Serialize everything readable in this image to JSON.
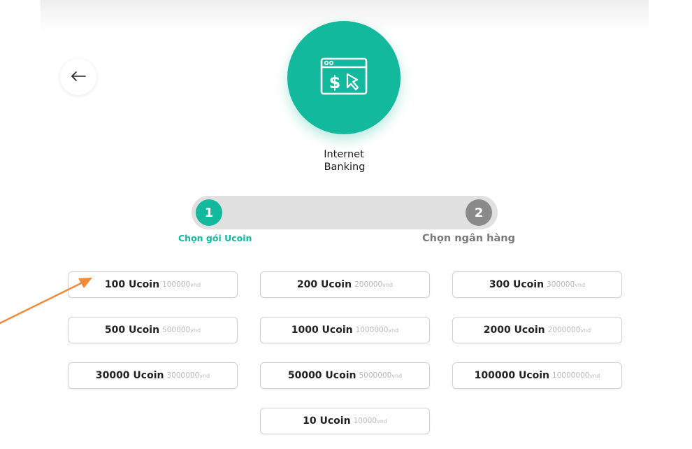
{
  "payment_method": {
    "icon": "online-payment-icon",
    "name_line1": "Internet",
    "name_line2": "Banking"
  },
  "back_icon": "arrow-left-icon",
  "stepper": {
    "steps": [
      {
        "number": "1",
        "label": "Chọn gói Ucoin",
        "active": true
      },
      {
        "number": "2",
        "label": "Chọn ngân hàng",
        "active": false
      }
    ]
  },
  "packages": [
    {
      "ucoin": "100 Ucoin",
      "price": "100000",
      "unit": "vnd"
    },
    {
      "ucoin": "200 Ucoin",
      "price": "200000",
      "unit": "vnd"
    },
    {
      "ucoin": "300 Ucoin",
      "price": "300000",
      "unit": "vnd"
    },
    {
      "ucoin": "500 Ucoin",
      "price": "500000",
      "unit": "vnd"
    },
    {
      "ucoin": "1000 Ucoin",
      "price": "1000000",
      "unit": "vnd"
    },
    {
      "ucoin": "2000 Ucoin",
      "price": "2000000",
      "unit": "vnd"
    },
    {
      "ucoin": "30000 Ucoin",
      "price": "3000000",
      "unit": "vnd"
    },
    {
      "ucoin": "50000 Ucoin",
      "price": "5000000",
      "unit": "vnd"
    },
    {
      "ucoin": "100000 Ucoin",
      "price": "10000000",
      "unit": "vnd"
    },
    {
      "ucoin": "10 Ucoin",
      "price": "10000",
      "unit": "vnd"
    }
  ],
  "colors": {
    "accent": "#13b99c",
    "inactive_step": "#8a8a8a",
    "annotation_arrow": "#f08a3c"
  }
}
